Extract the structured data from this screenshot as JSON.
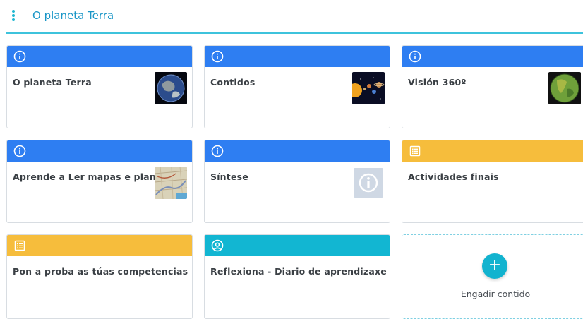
{
  "header": {
    "title": "O planeta Terra"
  },
  "cards": [
    {
      "title": "O planeta Terra",
      "type": "info",
      "color": "#2e7ef2",
      "thumb": "earth-globe"
    },
    {
      "title": "Contidos",
      "type": "info",
      "color": "#2e7ef2",
      "thumb": "solar-system"
    },
    {
      "title": "Visión 360º",
      "type": "info",
      "color": "#2e7ef2",
      "thumb": "green-globe"
    },
    {
      "title": "Aprende a Ler mapas e planos",
      "type": "info",
      "color": "#2e7ef2",
      "thumb": "map"
    },
    {
      "title": "Síntese",
      "type": "info",
      "color": "#2e7ef2",
      "thumb": "info-placeholder"
    },
    {
      "title": "Actividades finais",
      "type": "activity",
      "color": "#f6bd3c",
      "thumb": ""
    },
    {
      "title": "Pon a proba as túas competencias",
      "type": "activity",
      "color": "#f6bd3c",
      "thumb": ""
    },
    {
      "title": "Reflexiona - Diario de aprendizaxe",
      "type": "reflection",
      "color": "#12b6d2",
      "thumb": ""
    }
  ],
  "add": {
    "label": "Engadir contido",
    "button": "+"
  }
}
